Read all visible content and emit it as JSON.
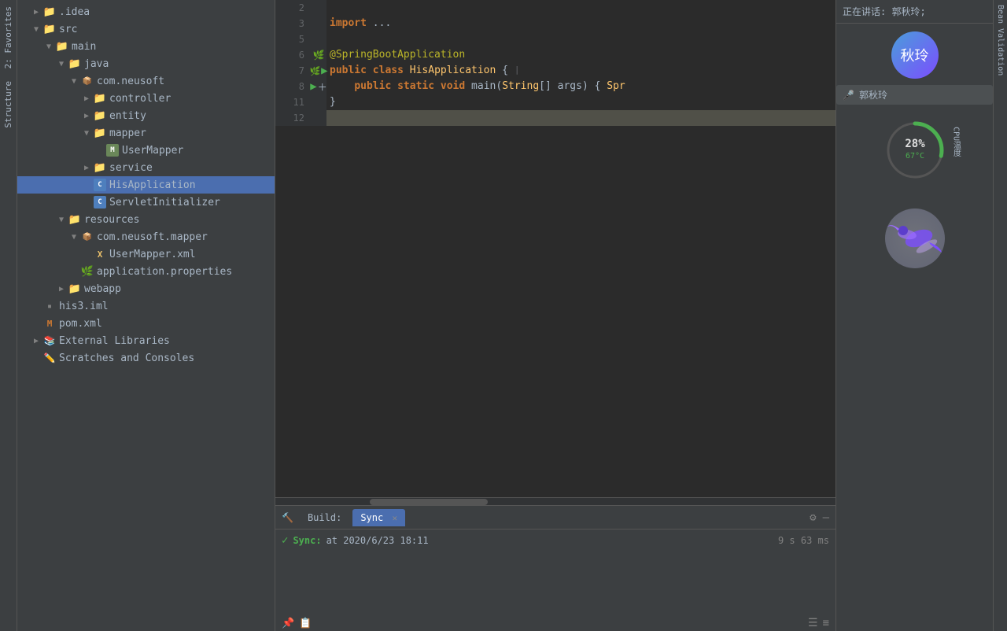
{
  "sidebar": {
    "items": [
      {
        "id": "idea",
        "label": ".idea",
        "indent": 0,
        "type": "folder",
        "expanded": false
      },
      {
        "id": "src",
        "label": "src",
        "indent": 0,
        "type": "folder",
        "expanded": true
      },
      {
        "id": "main",
        "label": "main",
        "indent": 1,
        "type": "folder",
        "expanded": true
      },
      {
        "id": "java",
        "label": "java",
        "indent": 2,
        "type": "folder",
        "expanded": true
      },
      {
        "id": "com-neusoft",
        "label": "com.neusoft",
        "indent": 3,
        "type": "package",
        "expanded": true
      },
      {
        "id": "controller",
        "label": "controller",
        "indent": 4,
        "type": "folder",
        "expanded": false
      },
      {
        "id": "entity",
        "label": "entity",
        "indent": 4,
        "type": "folder",
        "expanded": false
      },
      {
        "id": "mapper",
        "label": "mapper",
        "indent": 4,
        "type": "folder",
        "expanded": true
      },
      {
        "id": "UserMapper",
        "label": "UserMapper",
        "indent": 5,
        "type": "mapper"
      },
      {
        "id": "service",
        "label": "service",
        "indent": 4,
        "type": "folder",
        "expanded": false
      },
      {
        "id": "HisApplication",
        "label": "HisApplication",
        "indent": 4,
        "type": "class",
        "selected": true
      },
      {
        "id": "ServletInitializer",
        "label": "ServletInitializer",
        "indent": 4,
        "type": "class"
      },
      {
        "id": "resources",
        "label": "resources",
        "indent": 2,
        "type": "folder",
        "expanded": true
      },
      {
        "id": "com-neusoft-mapper",
        "label": "com.neusoft.mapper",
        "indent": 3,
        "type": "package",
        "expanded": true
      },
      {
        "id": "UserMapperXml",
        "label": "UserMapper.xml",
        "indent": 4,
        "type": "xml"
      },
      {
        "id": "application",
        "label": "application.properties",
        "indent": 3,
        "type": "properties"
      },
      {
        "id": "webapp",
        "label": "webapp",
        "indent": 2,
        "type": "folder",
        "expanded": false
      },
      {
        "id": "his3iml",
        "label": "his3.iml",
        "indent": 0,
        "type": "iml"
      },
      {
        "id": "pomxml",
        "label": "pom.xml",
        "indent": 0,
        "type": "pom"
      },
      {
        "id": "external-libs",
        "label": "External Libraries",
        "indent": 0,
        "type": "ext"
      },
      {
        "id": "scratches",
        "label": "Scratches and Consoles",
        "indent": 0,
        "type": "scratch"
      }
    ]
  },
  "editor": {
    "lines": [
      {
        "num": 2,
        "content": "",
        "gutter": ""
      },
      {
        "num": 3,
        "content": "import ...",
        "gutter": ""
      },
      {
        "num": 5,
        "content": "",
        "gutter": ""
      },
      {
        "num": 6,
        "content": "@SpringBootApplication",
        "gutter": "spring"
      },
      {
        "num": 7,
        "content": "public class HisApplication {",
        "gutter": "debugrun"
      },
      {
        "num": 8,
        "content": "    public static void main(String[] args) { Spr",
        "gutter": "run",
        "hasAdd": true
      },
      {
        "num": 11,
        "content": "}",
        "gutter": ""
      },
      {
        "num": 12,
        "content": "",
        "gutter": "",
        "highlighted": true
      }
    ]
  },
  "right_panel": {
    "speaking_label": "正在讲话: 郭秋玲;",
    "avatar_text": "秋玲",
    "speaker_name": "郭秋玲",
    "cpu_pct": "28%",
    "cpu_temp": "67°C",
    "cpu_label": "CPU温度"
  },
  "bottom": {
    "tab_build": "Build:",
    "tab_sync": "Sync",
    "sync_result": "✓  Sync:",
    "sync_time": "at 2020/6/23 18:11",
    "sync_duration": "9 s 63 ms"
  },
  "side_tabs": {
    "left": [
      "2: Favorites",
      "Structure"
    ]
  },
  "right_side_tabs": [
    "Bean Validation"
  ]
}
